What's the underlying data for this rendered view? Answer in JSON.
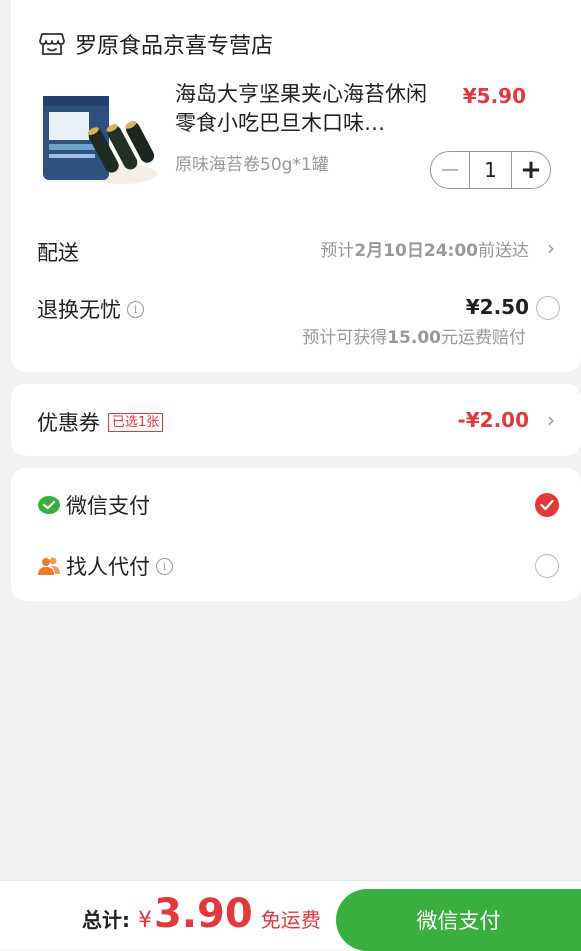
{
  "shop": {
    "name": "罗原食品京喜专营店",
    "icon": "store-icon"
  },
  "product": {
    "title": "海岛大亨坚果夹心海苔休闲零食小吃巴旦木口味…",
    "price": "¥5.90",
    "spec": "原味海苔卷50g*1罐",
    "quantity": "1",
    "minus_label": "−",
    "plus_label": "+",
    "image_label": "原味海苔卷"
  },
  "delivery": {
    "label": "配送",
    "value_prefix": "预计",
    "value_date": "2月10日24:00",
    "value_suffix": "前送达"
  },
  "return_service": {
    "label": "退换无忧",
    "price": "¥2.50",
    "note_prefix": "预计可获得",
    "note_amount": "15.00",
    "note_suffix": "元运费赔付",
    "selected": false
  },
  "coupon": {
    "label": "优惠券",
    "badge": "已选1张",
    "value": "-¥2.00"
  },
  "payment": {
    "options": [
      {
        "label": "微信支付",
        "icon": "wechat-icon",
        "selected": true
      },
      {
        "label": "找人代付",
        "icon": "friends-icon",
        "selected": false
      }
    ]
  },
  "footer": {
    "total_label": "总计:",
    "currency": "¥",
    "amount": "3.90",
    "free_shipping": "免运费",
    "pay_button": "微信支付"
  },
  "colors": {
    "accent_red": "#e4393c",
    "wechat_green": "#3aae3e"
  }
}
